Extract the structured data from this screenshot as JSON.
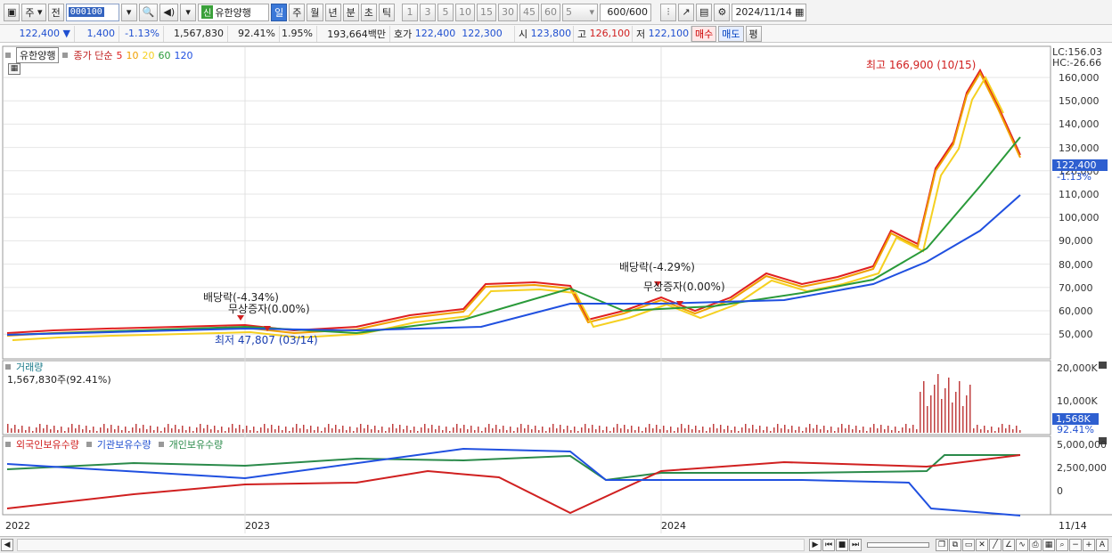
{
  "toolbar": {
    "period_select": "주",
    "prev_label": "전",
    "code": "000100",
    "stock_badge": "신",
    "stock_name": "유한양행",
    "tabs": [
      "일",
      "주",
      "월",
      "년",
      "분",
      "초",
      "틱"
    ],
    "active_tab": "일",
    "intervals": [
      "1",
      "3",
      "5",
      "10",
      "15",
      "30",
      "45",
      "60"
    ],
    "custom_interval": "5",
    "count": "600/600",
    "date": "2024/11/14"
  },
  "quote": {
    "price": "122,400",
    "change_arrow": "▼",
    "change": "1,400",
    "change_pct": "-1.13%",
    "volume": "1,567,830",
    "vol_ratio": "92.41%",
    "turnover": "1.95%",
    "amount": "193,664백만",
    "bid_label": "호가",
    "ask": "122,400",
    "bid": "122,300",
    "open_label": "시",
    "open": "123,800",
    "high_label": "고",
    "high": "126,100",
    "low_label": "저",
    "low": "122,100",
    "buy_label": "매수",
    "sell_label": "매도",
    "eval_label": "평"
  },
  "price_panel": {
    "legend_name": "유한양행",
    "ma_label": "종가 단순",
    "ma_periods": [
      "5",
      "10",
      "20",
      "60",
      "120"
    ],
    "ma_colors": [
      "#e02020",
      "#f0a000",
      "#f5d020",
      "#2a9a3a",
      "#2050e0"
    ],
    "lc": "LC:156.03",
    "hc": "HC:-26.66",
    "y_ticks": [
      "160,000",
      "150,000",
      "140,000",
      "130,000",
      "120,000",
      "110,000",
      "100,000",
      "90,000",
      "80,000",
      "70,000",
      "60,000",
      "50,000"
    ],
    "last_price": "122,400",
    "last_pct": "-1.13%",
    "high_note": "최고 166,900 (10/15)",
    "low_note": "최저 47,807 (03/14)",
    "events": [
      {
        "label": "배당락(-4.34%)"
      },
      {
        "label": "무상증자(0.00%)"
      },
      {
        "label": "배당락(-4.29%)"
      },
      {
        "label": "무상증자(0.00%)"
      }
    ]
  },
  "volume_panel": {
    "title": "거래량",
    "value": "1,567,830주(92.41%)",
    "y_ticks": [
      "20,000K",
      "10,000K"
    ],
    "last_value": "1,568K",
    "last_pct": "92.41%"
  },
  "holdings_panel": {
    "series": [
      {
        "name": "외국인보유수량",
        "color": "#d02020"
      },
      {
        "name": "기관보유수량",
        "color": "#2050e0"
      },
      {
        "name": "개인보유수량",
        "color": "#2a8a4a"
      }
    ],
    "y_ticks": [
      "5,000,000",
      "2,500,000",
      "0"
    ]
  },
  "x_axis": {
    "labels": [
      "2022",
      "2023",
      "2024"
    ],
    "last_date": "11/14"
  }
}
